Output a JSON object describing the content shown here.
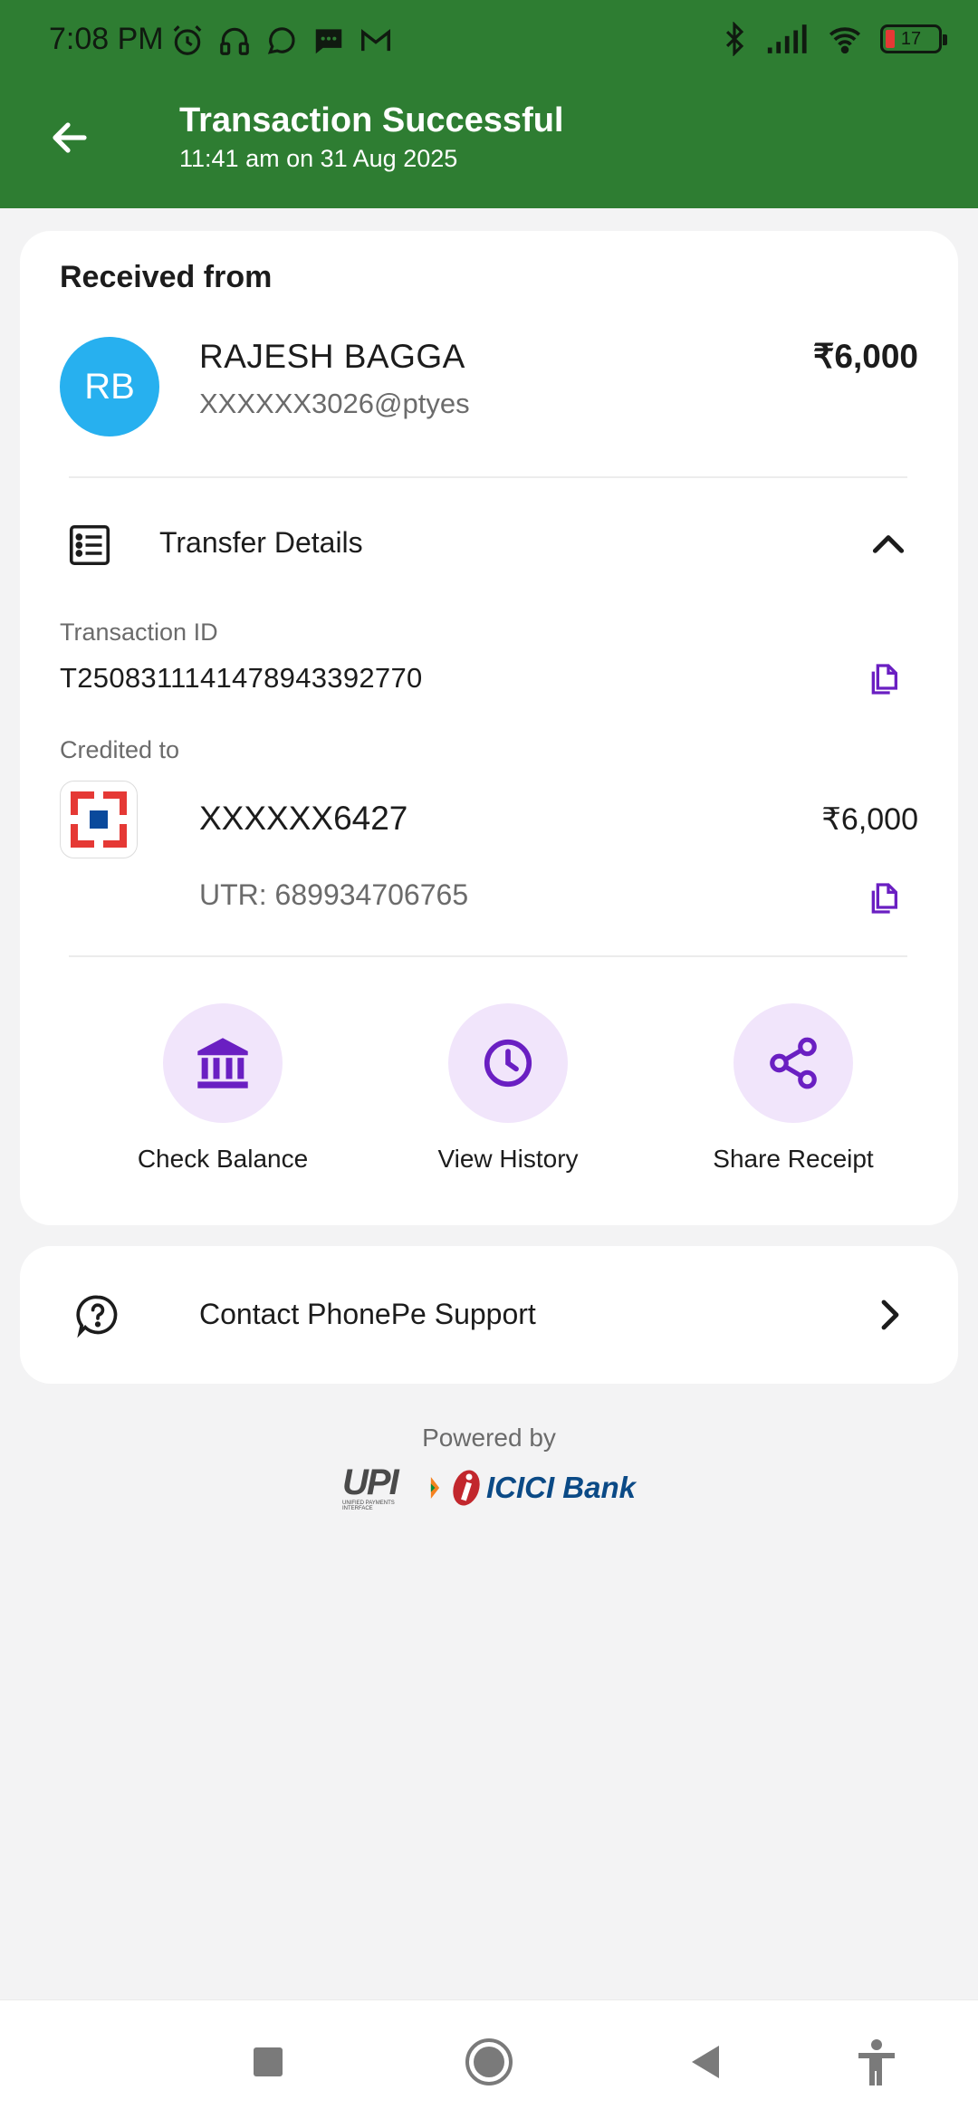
{
  "status_bar": {
    "time": "7:08 PM",
    "battery": "17",
    "icons_left": [
      "alarm-icon",
      "headset-icon",
      "whatsapp-icon",
      "sms-icon",
      "gmail-icon"
    ],
    "icons_right": [
      "bluetooth-icon",
      "signal-icon",
      "wifi-icon",
      "battery-icon"
    ]
  },
  "header": {
    "title": "Transaction Successful",
    "subtitle": "11:41 am on 31 Aug 2025",
    "background": "#2e7d32"
  },
  "received": {
    "label": "Received from",
    "initials": "RB",
    "name": "RAJESH BAGGA",
    "upi_id": "XXXXXX3026@ptyes",
    "amount": "₹6,000"
  },
  "transfer_details": {
    "label": "Transfer Details",
    "transaction_id_label": "Transaction ID",
    "transaction_id": "T2508311141478943392770",
    "credited_to_label": "Credited to",
    "account": "XXXXXX6427",
    "credited_amount": "₹6,000",
    "utr": "UTR: 689934706765"
  },
  "actions": [
    {
      "label": "Check Balance",
      "icon": "bank-icon"
    },
    {
      "label": "View History",
      "icon": "clock-icon"
    },
    {
      "label": "Share Receipt",
      "icon": "share-icon"
    }
  ],
  "support": {
    "label": "Contact PhonePe Support"
  },
  "footer": {
    "powered_by": "Powered by",
    "upi_logo": "UPI",
    "upi_tagline": "UNIFIED PAYMENTS INTERFACE",
    "bank_logo": "ICICI Bank"
  },
  "colors": {
    "accent_purple": "#6a1fc2",
    "action_bg": "#f1e5fb",
    "avatar_bg": "#27b0ef"
  }
}
